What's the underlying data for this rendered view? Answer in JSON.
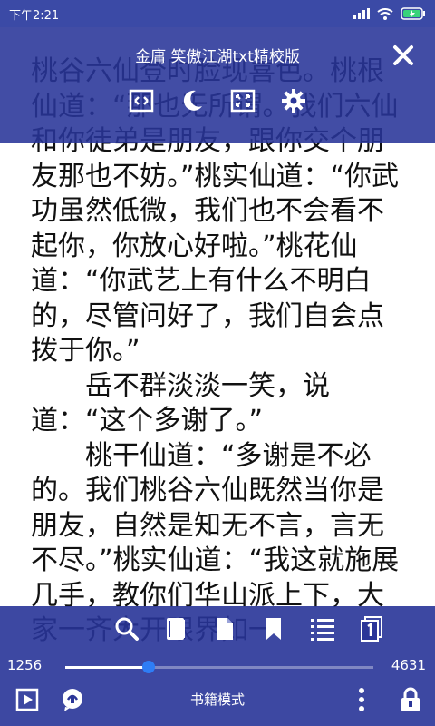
{
  "status": {
    "time": "下午2:21"
  },
  "header": {
    "title": "金庸 笑傲江湖txt精校版"
  },
  "content": {
    "paragraphs": [
      "桃谷六仙登时脸现喜色。桃根仙道：“那也无所谓。我们六仙和你徒弟是朋友，跟你交个朋友那也不妨。”桃实仙道：“你武功虽然低微，我们也不会看不起你，你放心好啦。”桃花仙道：“你武艺上有什么不明白的，尽管问好了，我们自会点拨于你。”",
      "　　岳不群淡淡一笑，说道：“这个多谢了。”",
      "　　桃干仙道：“多谢是不必的。我们桃谷六仙既然当你是朋友，自然是知无不言，言无不尽。”桃实仙道：“我这就施展几手，教你们华山派上下，大家一齐大开眼界如一"
    ]
  },
  "progress": {
    "current": "1256",
    "total": "4631",
    "fraction": 0.271
  },
  "footer": {
    "mode_label": "书籍模式"
  },
  "colors": {
    "bar": "#2a3598",
    "accent": "#2e7df6"
  }
}
